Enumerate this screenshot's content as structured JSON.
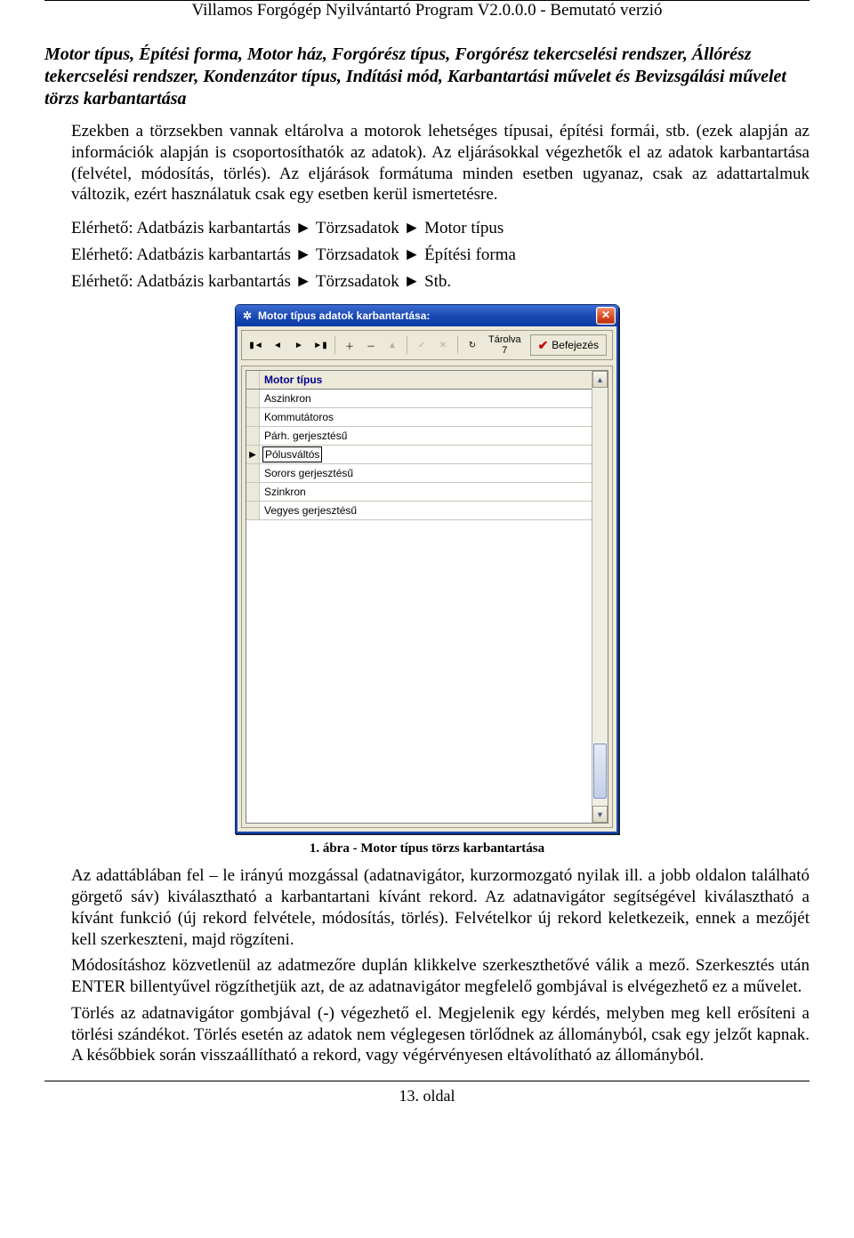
{
  "header_title": "Villamos Forgógép Nyilvántartó Program V2.0.0.0 - Bemutató verzió",
  "section_heading": "Motor típus, Építési forma, Motor ház, Forgórész típus, Forgórész tekercselési rendszer, Állórész tekercselési rendszer, Kondenzátor típus, Indítási mód, Karbantartási művelet és Bevizsgálási művelet törzs karbantartása",
  "p1": "Ezekben a törzsekben vannak eltárolva a motorok lehetséges típusai, építési formái, stb. (ezek alapján az információk alapján is csoportosíthatók az adatok). Az eljárásokkal végezhetők el az adatok karbantartása (felvétel, módosítás, törlés). Az eljárások formátuma minden esetben ugyanaz, csak az adattartalmuk változik, ezért használatuk csak egy esetben kerül ismertetésre.",
  "reach1": "Elérhető: Adatbázis karbantartás ► Törzsadatok ► Motor típus",
  "reach2": "Elérhető: Adatbázis karbantartás ► Törzsadatok ► Építési forma",
  "reach3": "Elérhető: Adatbázis karbantartás ► Törzsadatok ► Stb.",
  "win": {
    "title": "Motor típus adatok karbantartása:",
    "tarolva_label": "Tárolva",
    "tarolva_count": "7",
    "done": "Befejezés",
    "column_header": "Motor típus",
    "rows": [
      "Aszinkron",
      "Kommutátoros",
      "Párh. gerjesztésű",
      "Pólusváltós",
      "Sorors gerjesztésű",
      "Szinkron",
      "Vegyes gerjesztésű"
    ],
    "editing_index": 3
  },
  "caption": "1. ábra - Motor típus törzs karbantartása",
  "p2": "Az adattáblában fel – le irányú mozgással (adatnavigátor, kurzormozgató nyilak ill. a jobb oldalon található görgető sáv) kiválasztható a karbantartani kívánt rekord. Az adatnavigátor segítségével kiválasztható a kívánt funkció (új rekord felvétele, módosítás, törlés). Felvételkor új rekord keletkezeik, ennek a mezőjét kell szerkeszteni, majd rögzíteni.",
  "p3": "Módosításhoz közvetlenül az adatmezőre duplán klikkelve szerkeszthetővé válik a mező. Szerkesztés után ENTER billentyűvel rögzíthetjük azt, de az adatnavigátor megfelelő gombjával is elvégezhető ez a művelet.",
  "p4": "Törlés az adatnavigátor gombjával (-) végezhető el. Megjelenik egy kérdés, melyben meg kell erősíteni a törlési szándékot. Törlés esetén az adatok nem véglegesen törlődnek az állományból, csak egy jelzőt kapnak. A későbbiek során visszaállítható a rekord, vagy végérvényesen eltávolítható az állományból.",
  "footer": "13. oldal"
}
